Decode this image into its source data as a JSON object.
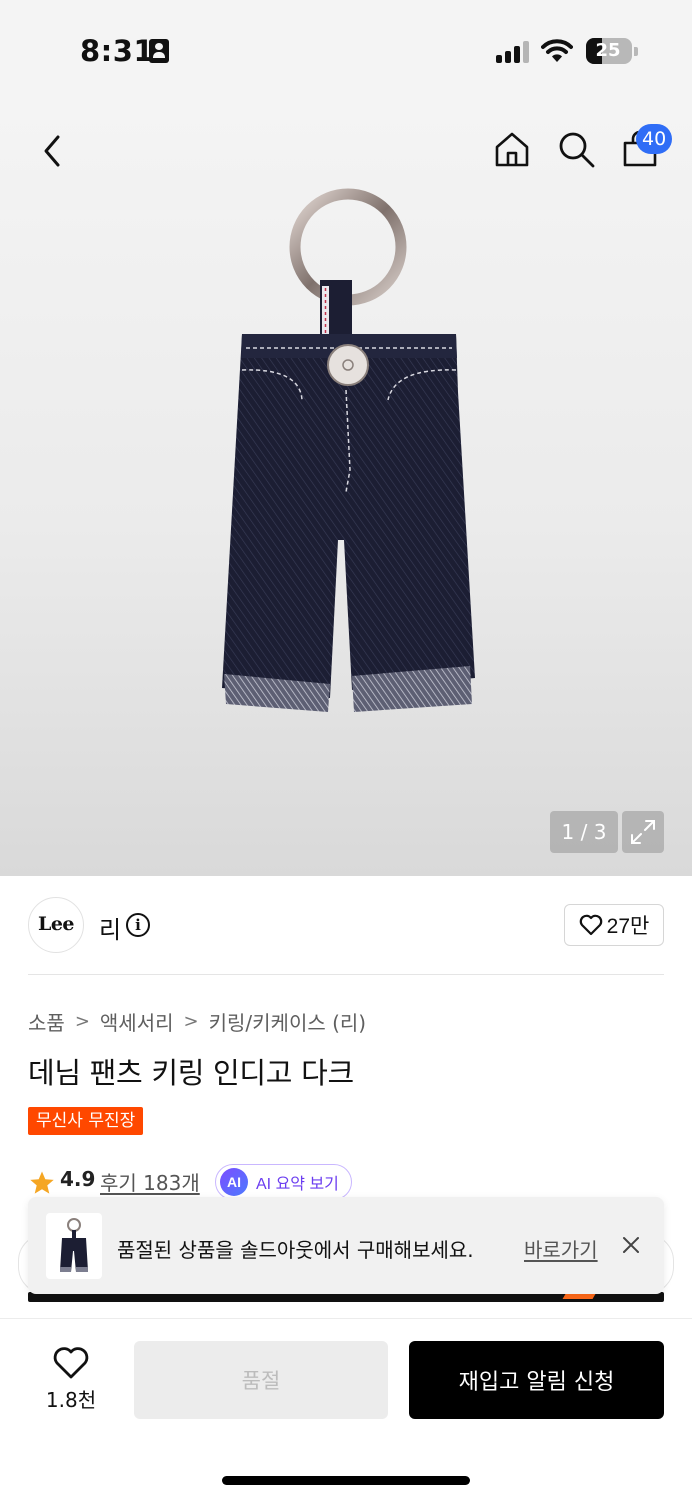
{
  "status_bar": {
    "time": "8:31",
    "battery_level": "25"
  },
  "nav": {
    "cart_count": "40",
    "icons": [
      "back-icon",
      "home-icon",
      "search-icon",
      "cart-icon"
    ]
  },
  "gallery": {
    "pager": "1 / 3"
  },
  "brand": {
    "logo_text": "Lee",
    "name": "리",
    "like_count": "27만"
  },
  "breadcrumb": [
    "소품",
    "액세서리",
    "키링/키케이스 (리)"
  ],
  "product": {
    "title": "데님 팬츠 키링 인디고 다크",
    "badge": "무신사 무진장"
  },
  "rating": {
    "score": "4.9",
    "reviews_label": "후기 183개",
    "ai_mark": "AI",
    "ai_label": "AI 요약 보기"
  },
  "toast": {
    "message": "품절된 상품을 솔드아웃에서 구매해보세요.",
    "link": "바로가기"
  },
  "bottom_bar": {
    "wish_count": "1.8천",
    "soldout_label": "품절",
    "restock_label": "재입고 알림 신청"
  },
  "colors": {
    "accent_blue": "#2f6df6",
    "exclusive_orange": "#ff4800",
    "ai_purple": "#6b3df0",
    "primary_black": "#000000"
  }
}
